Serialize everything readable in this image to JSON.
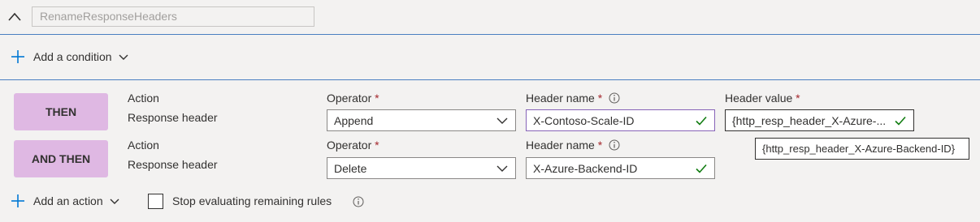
{
  "rule": {
    "name_placeholder": "RenameResponseHeaders",
    "add_condition_label": "Add a condition"
  },
  "rows": [
    {
      "badge": "THEN",
      "action_label": "Action",
      "action_value": "Response header",
      "operator_label": "Operator",
      "operator_value": "Append",
      "header_name_label": "Header name",
      "header_name_value": "X-Contoso-Scale-ID",
      "header_value_label": "Header value",
      "header_value_value": "{http_resp_header_X-Azure-..."
    },
    {
      "badge": "AND THEN",
      "action_label": "Action",
      "action_value": "Response header",
      "operator_label": "Operator",
      "operator_value": "Delete",
      "header_name_label": "Header name",
      "header_name_value": "X-Azure-Backend-ID"
    }
  ],
  "tooltip_text": "{http_resp_header_X-Azure-Backend-ID}",
  "footer": {
    "add_action_label": "Add an action",
    "stop_evaluating_label": "Stop evaluating remaining rules",
    "stop_evaluating_checked": false
  },
  "required_marker": "*",
  "colors": {
    "badge_bg": "#dfb8e3",
    "accent_blue": "#0078d4",
    "required_red": "#a4262c",
    "check_green": "#107c10",
    "focus_purple": "#8764b8"
  },
  "icons": [
    "chevron-up-icon",
    "plus-icon",
    "chevron-down-icon",
    "info-icon",
    "checkmark-icon"
  ]
}
